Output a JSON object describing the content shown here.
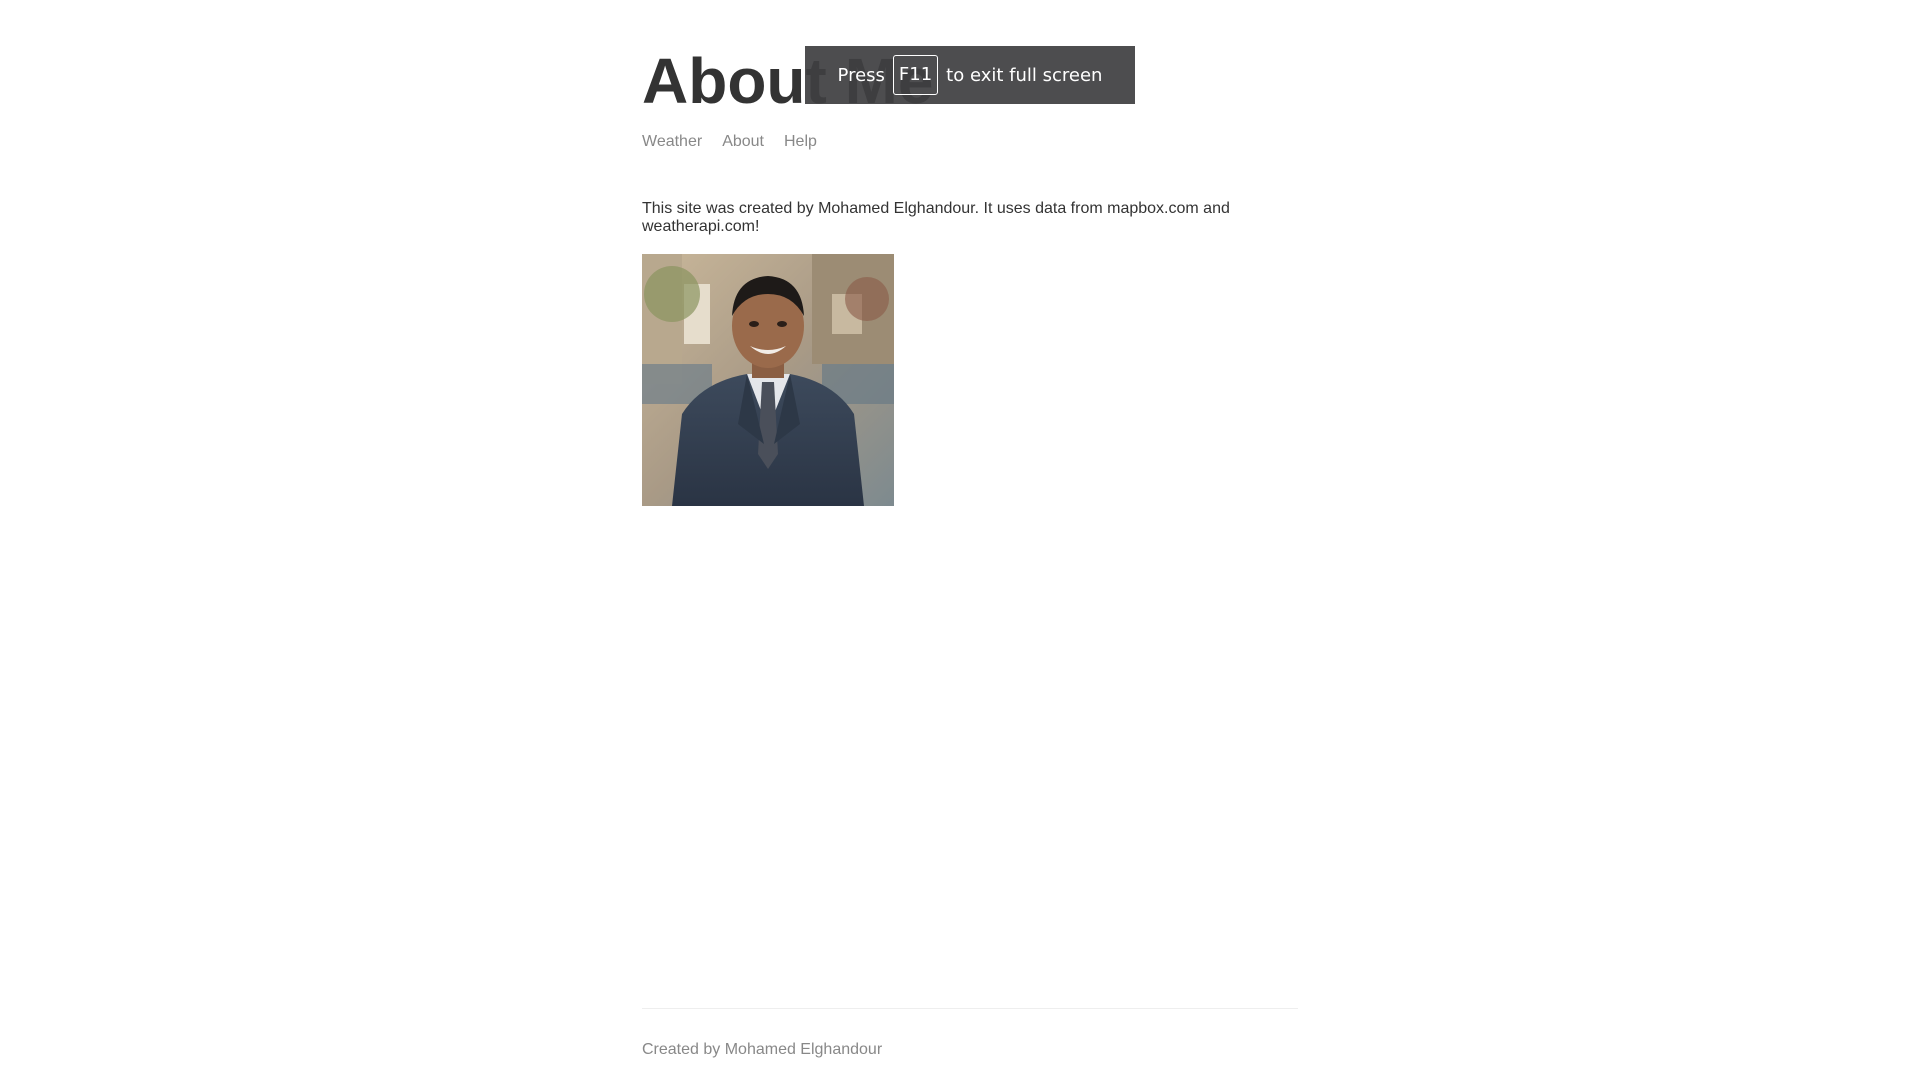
{
  "page": {
    "title": "About Me"
  },
  "nav": {
    "items": [
      {
        "label": "Weather"
      },
      {
        "label": "About"
      },
      {
        "label": "Help"
      }
    ]
  },
  "main": {
    "description": "This site was created by Mohamed Elghandour. It uses data from mapbox.com and weatherapi.com!"
  },
  "footer": {
    "text": "Created by Mohamed Elghandour"
  },
  "fullscreen_notice": {
    "prefix": "Press",
    "key": "F11",
    "suffix": "to exit full screen"
  }
}
